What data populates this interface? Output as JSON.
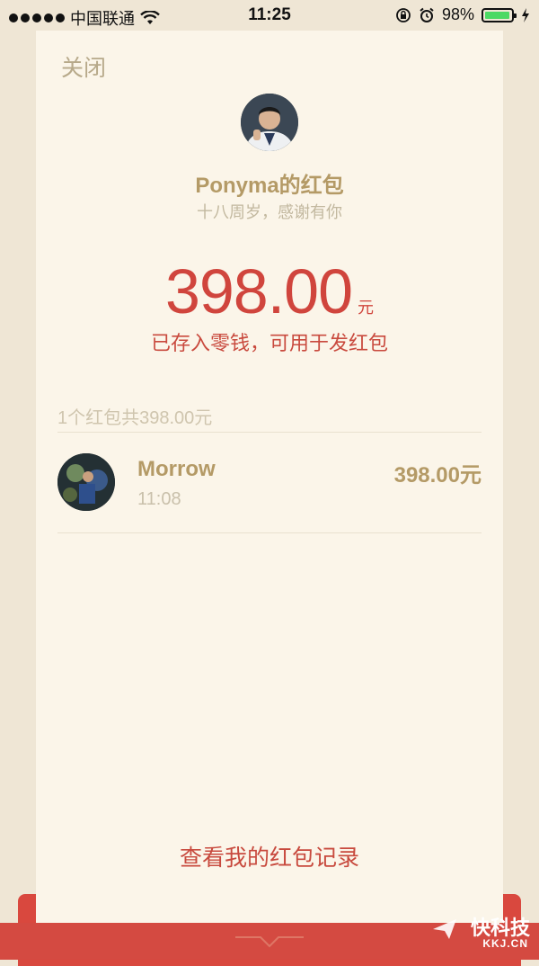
{
  "status_bar": {
    "carrier": "中国联通",
    "time": "11:25",
    "battery_percent": "98%",
    "battery_level": 0.98,
    "icons": [
      "signal-dots-icon",
      "wifi-icon",
      "orientation-lock-icon",
      "alarm-icon",
      "battery-icon",
      "charging-icon"
    ]
  },
  "card": {
    "close_label": "关闭",
    "sender_title": "Ponyma的红包",
    "greeting": "十八周岁，感谢有你",
    "amount": "398.00",
    "amount_unit": "元",
    "deposit_note": "已存入零钱，可用于发红包",
    "summary": "1个红包共398.00元",
    "receipt": {
      "name": "Morrow",
      "time": "11:08",
      "amount": "398.00元"
    },
    "records_link": "查看我的红包记录"
  },
  "watermark": {
    "text": "快科技",
    "sub": "KKJ.CN"
  },
  "colors": {
    "background": "#efe6d5",
    "card": "#fbf5e9",
    "accent_red": "#d0453d",
    "gold": "#b49a66",
    "envelope": "#d44a41"
  }
}
